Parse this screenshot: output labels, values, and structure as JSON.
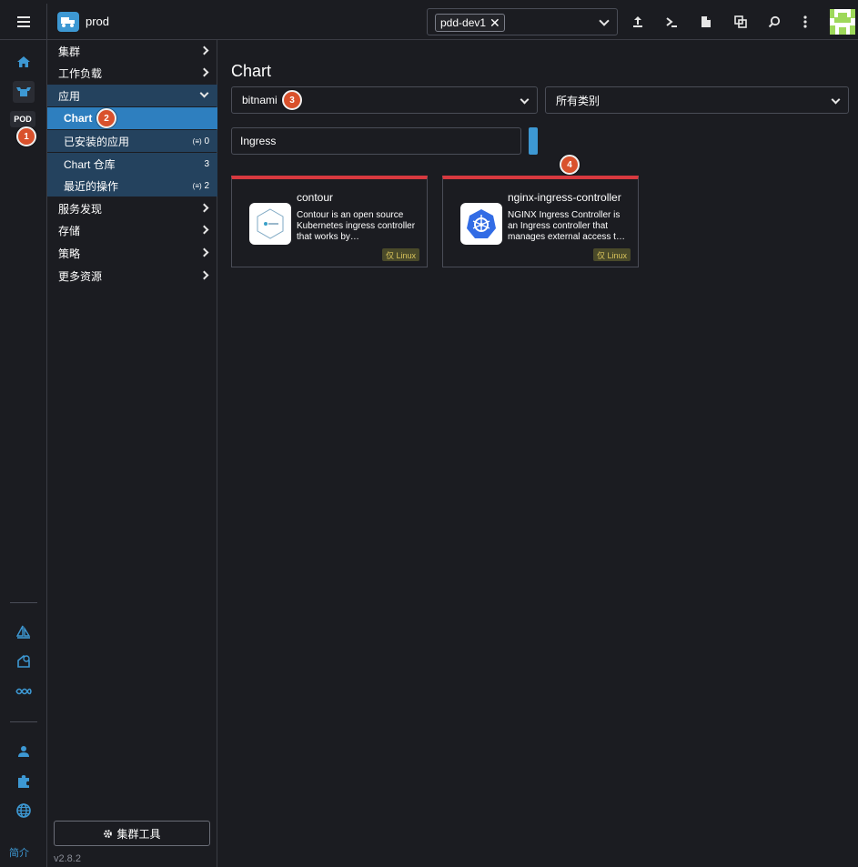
{
  "header": {
    "cluster_name": "prod",
    "namespace_tag": "pdd-dev1",
    "namespace_remove": "✕"
  },
  "rail": {
    "pod_label": "POD",
    "about": "简介"
  },
  "steps": [
    "1",
    "2",
    "3",
    "4"
  ],
  "nav": {
    "groups": {
      "cluster": "集群",
      "workloads": "工作负载",
      "apps": "应用",
      "service_discovery": "服务发现",
      "storage": "存储",
      "policy": "策略",
      "more": "更多资源"
    },
    "apps_items": [
      {
        "label": "Chart",
        "count": ""
      },
      {
        "label": "已安装的应用",
        "count": "0"
      },
      {
        "label": "Chart 仓库",
        "count": "3"
      },
      {
        "label": "最近的操作",
        "count": "2"
      }
    ],
    "cluster_tools": "集群工具",
    "version": "v2.8.2"
  },
  "main": {
    "title": "Chart",
    "repo_select": "bitnami",
    "category_select": "所有类别",
    "search_value": "Ingress"
  },
  "cards": [
    {
      "title": "contour",
      "description": "Contour is an open source Kubernetes ingress controller that works by…",
      "tag": "仅 Linux"
    },
    {
      "title": "nginx-ingress-controller",
      "description": "NGINX Ingress Controller is an Ingress controller that manages external access t…",
      "tag": "仅 Linux"
    }
  ],
  "colors": {
    "accent": "#3d98d3",
    "active_nav": "#2e7fbf",
    "card_top": "#d8393f",
    "step_badge": "#d9512c"
  }
}
